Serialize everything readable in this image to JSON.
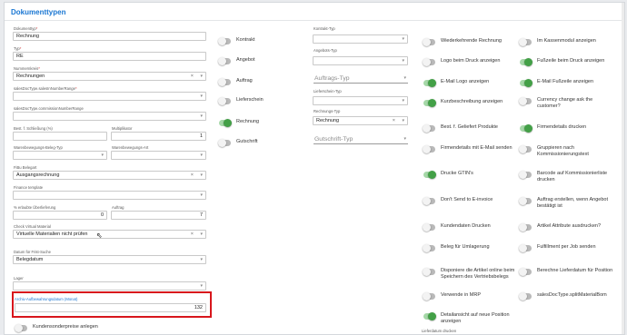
{
  "page_title": "Dokumenttypen",
  "col1": {
    "dokumenttyp": {
      "label": "Dokumenttyp",
      "value": "Rechnung"
    },
    "typ": {
      "label": "Typ",
      "value": "RE"
    },
    "nummernkreis": {
      "label": "Nummernkreis",
      "value": "Rechnungen",
      "clear": "×"
    },
    "sales_number_range": {
      "label": "salesDocType.salesInNumberRange",
      "value": ""
    },
    "commission_number_range": {
      "label": "salesDocType.commissionNumberRange",
      "value": ""
    },
    "schlieszung": {
      "label": "Best. f. Schließung (%)",
      "value": ""
    },
    "multiplikator": {
      "label": "Multiplikator",
      "value": "1"
    },
    "warenbewegungs_beleg_typ": {
      "label": "Warenbewegungs-Beleg-Typ",
      "value": ""
    },
    "warenbewegungs_art": {
      "label": "Warenbewegungs-Art",
      "value": ""
    },
    "fibu_belegart": {
      "label": "FiBu Belegart",
      "value": "Ausgangsrechnung",
      "clear": "×"
    },
    "finance_template": {
      "label": "Finance template",
      "value": ""
    },
    "ueberlieferung": {
      "label": "% erlaubte Überlieferung",
      "value": "0"
    },
    "auftrag": {
      "label": "Auftrag",
      "value": "7"
    },
    "check_virtual": {
      "label": "Check Virtual Material",
      "value": "Virtuelle Materialien nicht prüfen",
      "clear": "×"
    },
    "datum_frist": {
      "label": "Datum für Frist-Suche",
      "value": "Belegdatum"
    },
    "lager": {
      "label": "Lager",
      "value": ""
    },
    "archiv": {
      "label": "Archiv-Aufbewahrungsdatum (Monat)",
      "value": "132"
    },
    "kundensonderpreise": {
      "label": "Kundensonderpreise anlegen",
      "on": false
    }
  },
  "col2_toggles": [
    {
      "label": "Kontrakt",
      "on": false
    },
    {
      "label": "Angebot",
      "on": false
    },
    {
      "label": "Auftrag",
      "on": false
    },
    {
      "label": "Lieferschein",
      "on": false
    },
    {
      "label": "Rechnung",
      "on": true
    },
    {
      "label": "Gutschrift",
      "on": false
    }
  ],
  "col3": {
    "kontrakt_typ": {
      "label": "Kontrakt-Typ",
      "value": ""
    },
    "angebots_typ": {
      "label": "Angebots-Typ",
      "value": ""
    },
    "auftrags_typ": {
      "placeholder": "Auftrags-Typ"
    },
    "lieferschein_typ": {
      "label": "Lieferschein-Typ",
      "value": ""
    },
    "rechnungs_typ": {
      "label": "Rechnungs-Typ",
      "value": "Rechnung",
      "clear": "×"
    },
    "gutschrift_typ": {
      "placeholder": "Gutschrift-Typ"
    }
  },
  "col4_toggles": [
    {
      "label": "Wiederkehrende Rechnung",
      "on": false
    },
    {
      "label": "Logo beim Druck anzeigen",
      "on": false
    },
    {
      "label": "E-Mail Logo anzeigen",
      "on": true
    },
    {
      "label": "Kurzbeschreibung anzeigen",
      "on": true
    },
    {
      "label": "Best. f. Geliefert Produkte",
      "on": false
    },
    {
      "label": "Firmendetails mit E-Mail senden",
      "on": false
    },
    {
      "label": "Drucke GTIN's",
      "on": true
    },
    {
      "label": "Don't Send to E-invoice",
      "on": false
    },
    {
      "label": "Kundendaten Drucken",
      "on": false
    },
    {
      "label": "Beleg für Umlagerung",
      "on": false
    },
    {
      "label": "Disponiere die Artikel online beim Speichern des Vertriebsbelegs",
      "on": false
    },
    {
      "label": "Verwende in MRP",
      "on": false
    },
    {
      "label": "Detailansicht auf neue Position anzeigen",
      "on": true
    }
  ],
  "col4_footer_label": "Lieferdatum drucken",
  "col5_toggles": [
    {
      "label": "Im Kassenmodul anzeigen",
      "on": false
    },
    {
      "label": "Fußzeile beim Druck anzeigen",
      "on": true
    },
    {
      "label": "E-Mail Fußzeile anzeigen",
      "on": true
    },
    {
      "label": "Currency change ask the customer?",
      "on": false
    },
    {
      "label": "Firmendetails drucken",
      "on": true
    },
    {
      "label": "Gruppieren nach Kommissionierungstext",
      "on": false
    },
    {
      "label": "Barcode auf Kommissionierliste drucken",
      "on": false
    },
    {
      "label": "Auftrag erstellen, wenn Angebot bestätigt ist",
      "on": false
    },
    {
      "label": "Artikel Attribute ausdrucken?",
      "on": false
    },
    {
      "label": "Fulfillment per Job senden",
      "on": false
    },
    {
      "label": "Berechne Lieferdatum für Position",
      "on": false
    },
    {
      "label": "salesDocType.splitMaterialBom",
      "on": false
    }
  ],
  "colors": {
    "accent": "#1976d2",
    "toggle_on": "#43a047",
    "highlight": "#d8161c"
  }
}
